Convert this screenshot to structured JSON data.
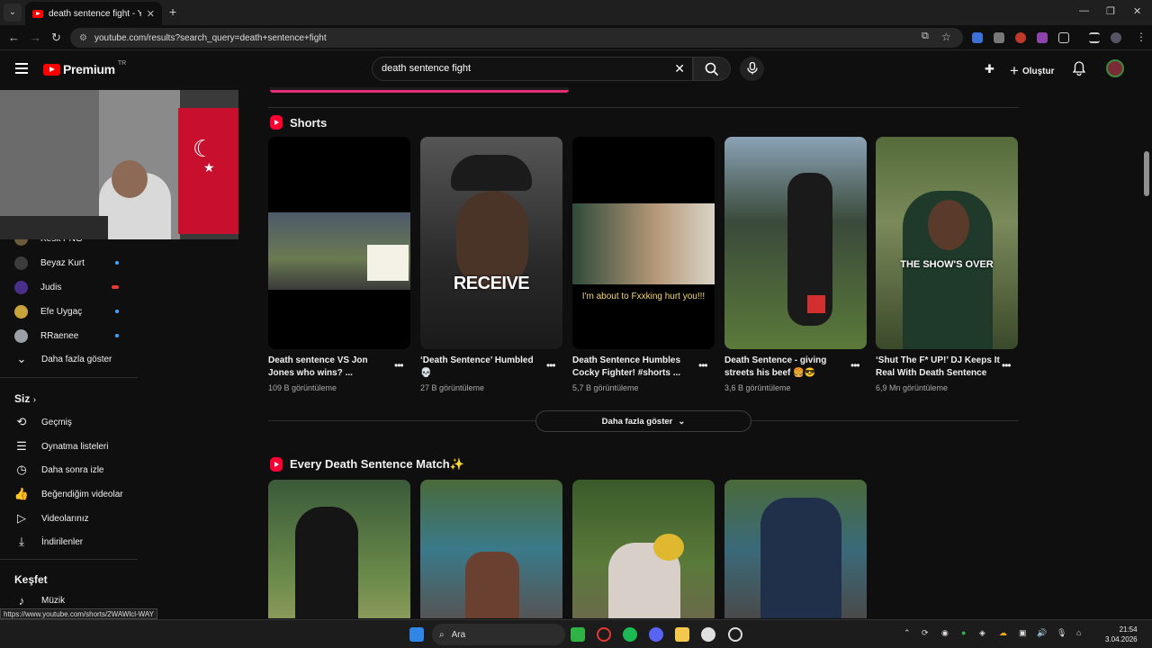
{
  "browser": {
    "tab_title": "death sentence fight - YouTube",
    "url": "youtube.com/results?search_query=death+sentence+fight",
    "status_url": "https://www.youtube.com/shorts/2WAWlcl-WAY"
  },
  "header": {
    "logo_text": "Premium",
    "country_code": "TR",
    "search_value": "death sentence fight",
    "create_label": "Oluştur"
  },
  "sidebar": {
    "subscriptions": [
      {
        "name": "Kesit PNG",
        "color": "#6b5a3a",
        "dot": false
      },
      {
        "name": "Beyaz Kurt",
        "color": "#3b3b3b",
        "dot": true
      },
      {
        "name": "Judis",
        "color": "#4a2f8a",
        "dot": true
      },
      {
        "name": "Efe Uygaç",
        "color": "#c8a23a",
        "dot": true
      },
      {
        "name": "RRaenee",
        "color": "#9aa0a6",
        "dot": true
      }
    ],
    "show_more": "Daha fazla göster",
    "you_header": "Siz",
    "you_items": [
      {
        "label": "Geçmiş",
        "icon": "history-icon"
      },
      {
        "label": "Oynatma listeleri",
        "icon": "playlists-icon"
      },
      {
        "label": "Daha sonra izle",
        "icon": "watch-later-icon"
      },
      {
        "label": "Beğendiğim videolar",
        "icon": "liked-icon"
      },
      {
        "label": "Videolarınız",
        "icon": "your-videos-icon"
      },
      {
        "label": "İndirilenler",
        "icon": "downloads-icon"
      }
    ],
    "explore_header": "Keşfet",
    "explore_items": [
      {
        "label": "Müzik",
        "icon": "music-icon"
      }
    ]
  },
  "shorts": {
    "title": "Shorts",
    "items": [
      {
        "title": "Death sentence VS Jon Jones who wins? ...",
        "views": "109 B görüntüleme"
      },
      {
        "title": "‘Death Sentence’ Humbled 💀",
        "views": "27 B görüntüleme",
        "overlay": "RECEIVE"
      },
      {
        "title": "Death Sentence Humbles Cocky Fighter! #shorts ...",
        "views": "5,7 B görüntüleme",
        "overlay": "I'm about to Fxxking hurt you!!!"
      },
      {
        "title": "Death Sentence - giving streets his beef 🍔😎",
        "views": "3,6 B görüntüleme"
      },
      {
        "title": "‘Shut The F* UP!’ DJ Keeps It Real With Death Sentence",
        "views": "6,9 Mn görüntüleme",
        "overlay": "THE SHOW'S OVER"
      }
    ],
    "show_more": "Daha fazla göster"
  },
  "playlist": {
    "title": "Every Death Sentence Match✨"
  },
  "taskbar": {
    "search_placeholder": "Ara",
    "time": "21:54",
    "date": "3.04.2026"
  }
}
